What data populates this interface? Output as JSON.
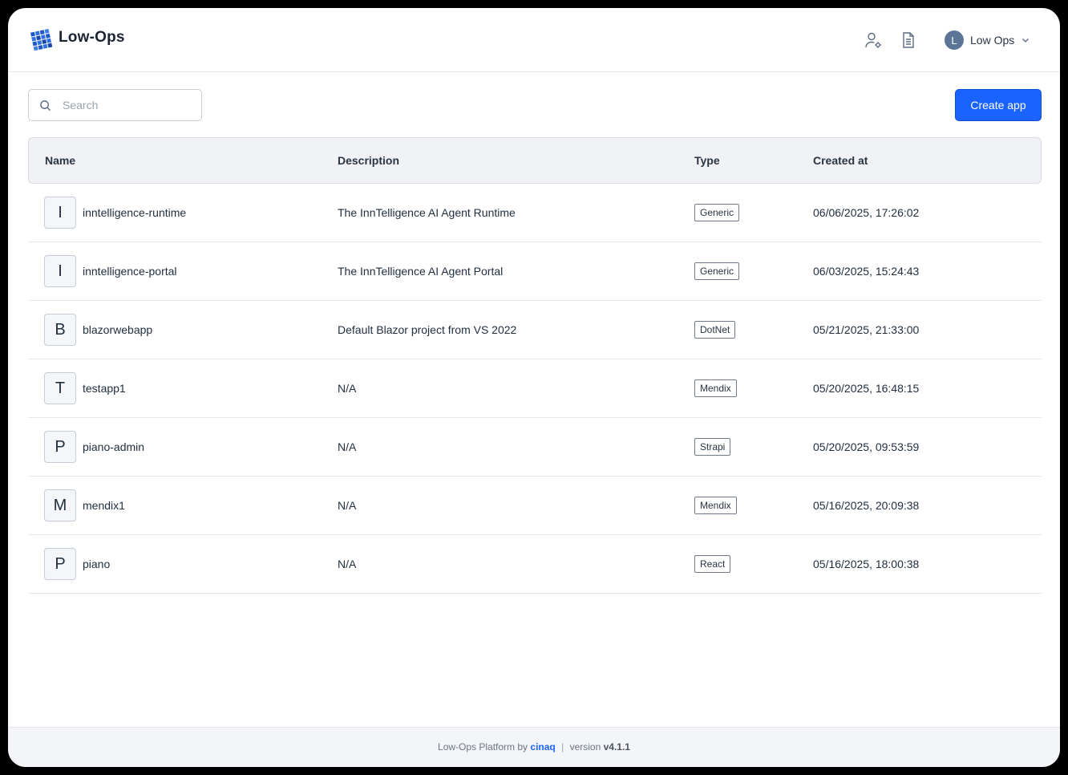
{
  "header": {
    "brand": "Low-Ops",
    "user": {
      "initial": "L",
      "name": "Low Ops"
    },
    "icons": [
      "user-settings-icon",
      "document-icon",
      "chevron-down-icon"
    ]
  },
  "toolbar": {
    "search_placeholder": "Search",
    "search_value": "",
    "create_label": "Create app",
    "accent_color": "#1b63ff"
  },
  "table": {
    "columns": [
      "Name",
      "Description",
      "Type",
      "Created at"
    ],
    "rows": [
      {
        "initial": "I",
        "name": "inntelligence-runtime",
        "description": "The InnTelligence AI Agent Runtime",
        "type": "Generic",
        "created": "06/06/2025, 17:26:02"
      },
      {
        "initial": "I",
        "name": "inntelligence-portal",
        "description": "The InnTelligence AI Agent Portal",
        "type": "Generic",
        "created": "06/03/2025, 15:24:43"
      },
      {
        "initial": "B",
        "name": "blazorwebapp",
        "description": "Default Blazor project from VS 2022",
        "type": "DotNet",
        "created": "05/21/2025, 21:33:00"
      },
      {
        "initial": "T",
        "name": "testapp1",
        "description": "N/A",
        "type": "Mendix",
        "created": "05/20/2025, 16:48:15"
      },
      {
        "initial": "P",
        "name": "piano-admin",
        "description": "N/A",
        "type": "Strapi",
        "created": "05/20/2025, 09:53:59"
      },
      {
        "initial": "M",
        "name": "mendix1",
        "description": "N/A",
        "type": "Mendix",
        "created": "05/16/2025, 20:09:38"
      },
      {
        "initial": "P",
        "name": "piano",
        "description": "N/A",
        "type": "React",
        "created": "05/16/2025, 18:00:38"
      }
    ]
  },
  "footer": {
    "prefix": "Low-Ops Platform by",
    "company": "cinaq",
    "separator": "|",
    "version_label": "version",
    "version": "v4.1.1"
  }
}
